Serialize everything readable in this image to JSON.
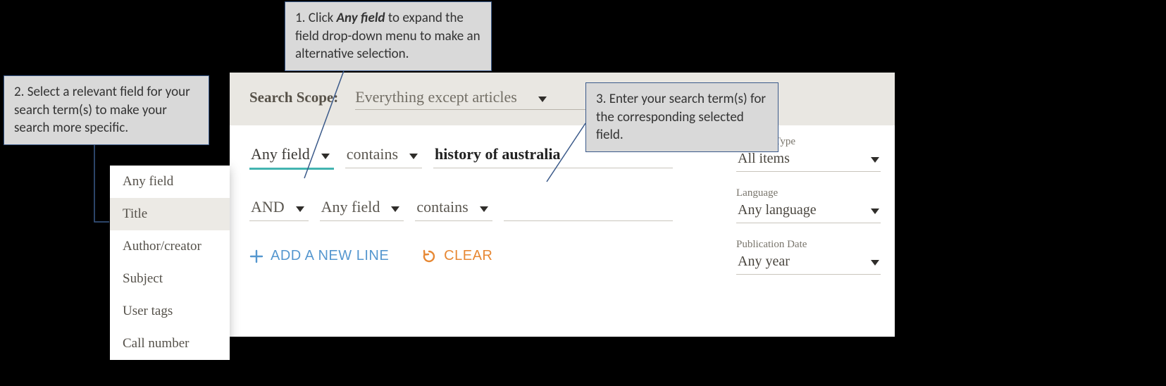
{
  "callouts": {
    "c1_pre": "1. Click ",
    "c1_bold": "Any field",
    "c1_post": " to expand the field drop-down menu to make an alternative selection.",
    "c2": "2. Select a relevant field for your search term(s) to make your search more specific.",
    "c3": "3. Enter your search term(s) for the corresponding selected field."
  },
  "scope": {
    "label": "Search Scope:",
    "value": "Everything except articles"
  },
  "row1": {
    "field": "Any field",
    "match": "contains",
    "term": "history of australia"
  },
  "row2": {
    "bool": "AND",
    "field": "Any field",
    "match": "contains",
    "term": ""
  },
  "actions": {
    "add": "ADD A NEW LINE",
    "clear": "CLEAR"
  },
  "filters": {
    "materialType": {
      "label": "Material Type",
      "value": "All items"
    },
    "language": {
      "label": "Language",
      "value": "Any language"
    },
    "pubDate": {
      "label": "Publication Date",
      "value": "Any year"
    }
  },
  "fieldMenu": [
    "Any field",
    "Title",
    "Author/creator",
    "Subject",
    "User tags",
    "Call number"
  ]
}
